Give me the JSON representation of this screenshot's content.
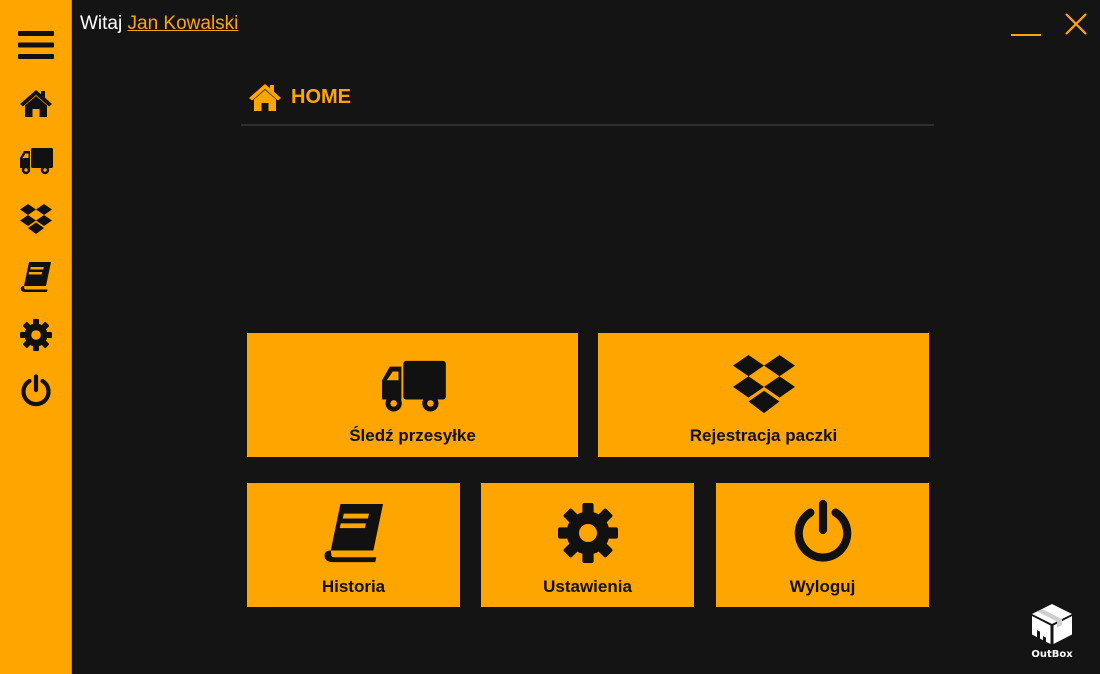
{
  "header": {
    "greeting_prefix": "Witaj",
    "user_name": "Jan Kowalski"
  },
  "window_controls": {
    "minimize_icon": "minimize-icon",
    "close_icon": "close-icon"
  },
  "sidebar": {
    "items": [
      {
        "icon": "menu-icon",
        "target": "menu"
      },
      {
        "icon": "home-icon",
        "target": "home"
      },
      {
        "icon": "truck-icon",
        "target": "tracking"
      },
      {
        "icon": "dropbox-icon",
        "target": "registration"
      },
      {
        "icon": "book-icon",
        "target": "history"
      },
      {
        "icon": "gear-icon",
        "target": "settings"
      },
      {
        "icon": "power-icon",
        "target": "logout"
      }
    ]
  },
  "page": {
    "title": "HOME",
    "icon": "home-icon"
  },
  "tiles": {
    "track": {
      "label": "Śledź przesyłke",
      "icon": "truck-icon"
    },
    "register": {
      "label": "Rejestracja paczki",
      "icon": "dropbox-icon"
    },
    "history": {
      "label": "Historia",
      "icon": "book-icon"
    },
    "settings": {
      "label": "Ustawienia",
      "icon": "gear-icon"
    },
    "logout": {
      "label": "Wyloguj",
      "icon": "power-icon"
    }
  },
  "logo": {
    "text": "OutBox",
    "icon": "box-icon"
  },
  "colors": {
    "accent": "#ffa500",
    "background": "#141414",
    "tile_text": "#111111"
  }
}
